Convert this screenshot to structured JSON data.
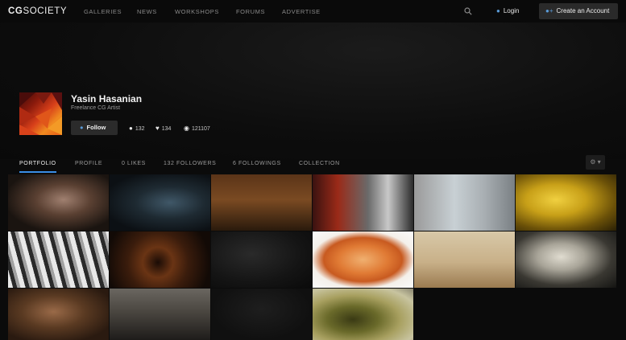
{
  "nav": {
    "logo_bold": "CG",
    "logo_thin": "SOCIETY",
    "links": [
      "GALLERIES",
      "NEWS",
      "WORKSHOPS",
      "FORUMS",
      "ADVERTISE"
    ],
    "login": "Login",
    "create_account": "Create an Account"
  },
  "profile": {
    "name": "Yasin Hasanian",
    "title": "Freelance CG Artist",
    "follow_label": "Follow",
    "followers": "132",
    "likes": "134",
    "views": "121107"
  },
  "tabs": [
    "PORTFOLIO",
    "PROFILE",
    "0 LIKES",
    "132 FOLLOWERS",
    "6 FOLLOWINGS",
    "COLLECTION"
  ],
  "active_tab": "PORTFOLIO",
  "colors": {
    "accent": "#3a8ee6",
    "icon_blue": "#5a9bd8"
  }
}
